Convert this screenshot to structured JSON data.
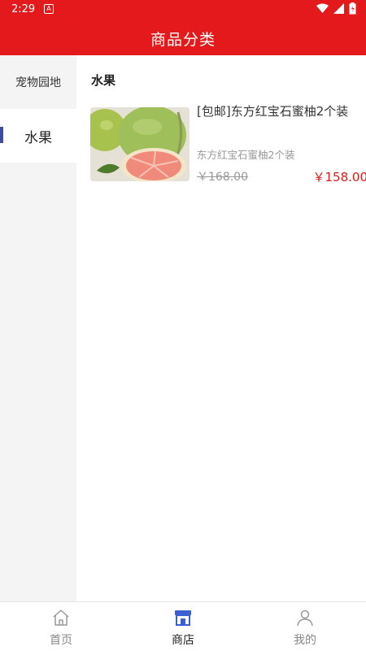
{
  "status_bar": {
    "time": "2:29",
    "notification_glyph": "A"
  },
  "header": {
    "title": "商品分类"
  },
  "sidebar": {
    "items": [
      {
        "label": "宠物园地",
        "active": false
      },
      {
        "label": "水果",
        "active": true
      }
    ]
  },
  "content": {
    "section_title": "水果",
    "products": [
      {
        "name": "[包邮]东方红宝石蜜柚2个装",
        "description": "东方红宝石蜜柚2个装",
        "original_price": "￥168.00",
        "price": "￥158.00",
        "image_icon": "pomelo-image"
      }
    ]
  },
  "tabbar": {
    "tabs": [
      {
        "label": "首页",
        "icon": "home-icon",
        "active": false
      },
      {
        "label": "商店",
        "icon": "shop-icon",
        "active": true
      },
      {
        "label": "我的",
        "icon": "user-icon",
        "active": false
      }
    ]
  },
  "colors": {
    "brand_red": "#e3191b",
    "active_indicator": "#3d4aa6",
    "active_tab_icon": "#3a5fd0"
  }
}
